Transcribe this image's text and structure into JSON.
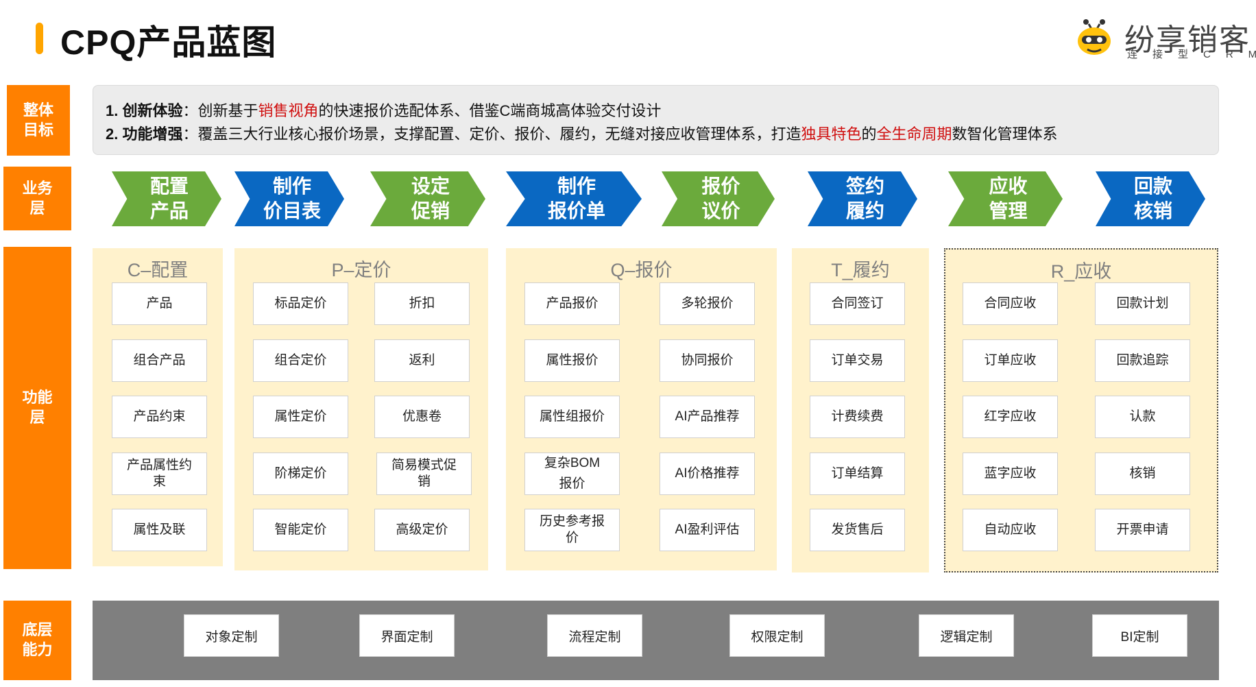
{
  "header": {
    "title": "CPQ产品蓝图",
    "logo_name": "纷享销客",
    "logo_sub": "连接型CRM",
    "logo_icon": "bee-mascot-icon"
  },
  "layers": {
    "goal": "整体\n目标",
    "business": "业务\n层",
    "function": "功能\n层",
    "base": "底层\n能力"
  },
  "goals": [
    {
      "lead": "1. 创新体验",
      "segments": [
        {
          "text": "：创新基于",
          "red": false
        },
        {
          "text": "销售视角",
          "red": true
        },
        {
          "text": "的快速报价选配体系、借鉴C端商城高体验交付设计",
          "red": false
        }
      ]
    },
    {
      "lead": "2. 功能增强",
      "segments": [
        {
          "text": "：覆盖三大行业核心报价场景，支撑配置、定价、报价、履约，无缝对接应收管理体系，打造",
          "red": false
        },
        {
          "text": "独具特色",
          "red": true
        },
        {
          "text": "的",
          "red": false
        },
        {
          "text": "全生命周期",
          "red": true
        },
        {
          "text": "数智化管理体系",
          "red": false
        }
      ]
    }
  ],
  "process": [
    {
      "label": "配置\n产品",
      "color": "green"
    },
    {
      "label": "制作\n价目表",
      "color": "blue"
    },
    {
      "label": "设定\n促销",
      "color": "green"
    },
    {
      "label": "制作\n报价单",
      "color": "blue"
    },
    {
      "label": "报价\n议价",
      "color": "green"
    },
    {
      "label": "签约\n履约",
      "color": "blue"
    },
    {
      "label": "应收\n管理",
      "color": "green"
    },
    {
      "label": "回款\n核销",
      "color": "blue"
    }
  ],
  "panels": [
    {
      "title": "C–配置",
      "columns": [
        [
          "产品",
          "组合产品",
          "产品约束",
          "产品属性约\n束",
          "属性及联"
        ]
      ]
    },
    {
      "title": "P–定价",
      "columns": [
        [
          "标品定价",
          "组合定价",
          "属性定价",
          "阶梯定价",
          "智能定价"
        ],
        [
          "折扣",
          "返利",
          "优惠卷",
          "简易模式促\n销",
          "高级定价"
        ]
      ]
    },
    {
      "title": "Q–报价",
      "columns": [
        [
          "产品报价",
          "属性报价",
          "属性组报价",
          "复杂BOM\n报价",
          "历史参考报\n价"
        ],
        [
          "多轮报价",
          "协同报价",
          "AI产品推荐",
          "AI价格推荐",
          "AI盈利评估"
        ]
      ]
    },
    {
      "title": "T_履约",
      "columns": [
        [
          "合同签订",
          "订单交易",
          "计费续费",
          "订单结算",
          "发货售后"
        ]
      ]
    },
    {
      "title": "R_应收",
      "columns": [
        [
          "合同应收",
          "订单应收",
          "红字应收",
          "蓝字应收",
          "自动应收"
        ],
        [
          "回款计划",
          "回款追踪",
          "认款",
          "核销",
          "开票申请"
        ]
      ]
    }
  ],
  "base": [
    "对象定制",
    "界面定制",
    "流程定制",
    "权限定制",
    "逻辑定制",
    "BI定制"
  ],
  "colors": {
    "side": "#FF8000",
    "green": "#6BAA3C",
    "blue": "#0A68C2",
    "panel": "#FFF2CC",
    "base": "#7F7F7F",
    "red": "#D01010"
  }
}
